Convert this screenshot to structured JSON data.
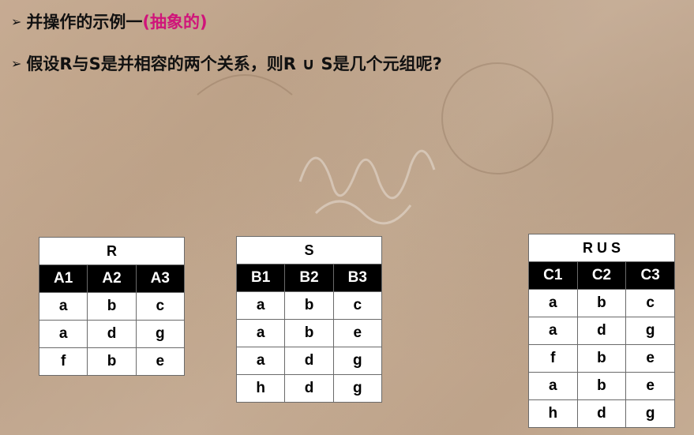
{
  "bullets": [
    {
      "text": "并操作的示例一",
      "accent": "(抽象的)"
    },
    {
      "text": "假设R与S是并相容的两个关系，则R ∪ S是几个元组呢?"
    }
  ],
  "tables": [
    {
      "title": "R",
      "headers": [
        "A1",
        "A2",
        "A3"
      ],
      "rows": [
        [
          "a",
          "b",
          "c"
        ],
        [
          "a",
          "d",
          "g"
        ],
        [
          "f",
          "b",
          "e"
        ]
      ]
    },
    {
      "title": "S",
      "headers": [
        "B1",
        "B2",
        "B3"
      ],
      "rows": [
        [
          "a",
          "b",
          "c"
        ],
        [
          "a",
          "b",
          "e"
        ],
        [
          "a",
          "d",
          "g"
        ],
        [
          "h",
          "d",
          "g"
        ]
      ]
    },
    {
      "title": "R U S",
      "headers": [
        "C1",
        "C2",
        "C3"
      ],
      "rows": [
        [
          "a",
          "b",
          "c"
        ],
        [
          "a",
          "d",
          "g"
        ],
        [
          "f",
          "b",
          "e"
        ],
        [
          "a",
          "b",
          "e"
        ],
        [
          "h",
          "d",
          "g"
        ]
      ]
    }
  ],
  "colors": {
    "accent": "#d0147a",
    "header_bg": "#000000",
    "header_fg": "#ffffff"
  }
}
